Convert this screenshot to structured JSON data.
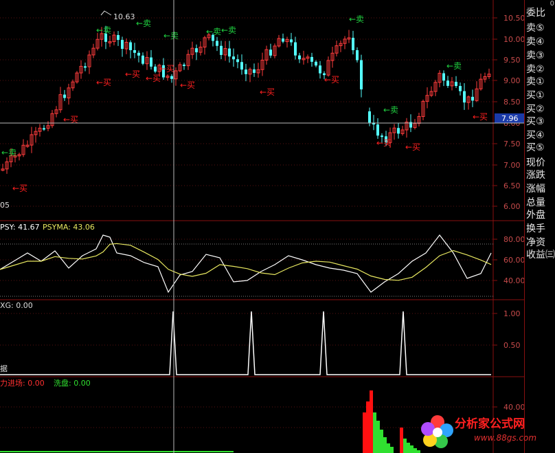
{
  "main_panel": {
    "price_axis": [
      "10.50",
      "10.00",
      "9.50",
      "9.00",
      "8.50",
      "8.00",
      "7.50",
      "7.00",
      "6.50",
      "6.00"
    ],
    "high_label": "10.63",
    "low_label_partial": "05",
    "current_price_tag": "7.96",
    "buy_label": "买",
    "sell_label": "卖"
  },
  "psy_panel": {
    "psy_label": "PSY: 41.67",
    "psyma_label": "PSYMA: 43.06",
    "axis": [
      "80.00",
      "60.00",
      "40.00"
    ]
  },
  "xg_panel": {
    "xg_label": "XG: 0.00",
    "axis": [
      "1.00",
      "0.50"
    ],
    "left_char": "据"
  },
  "capital_panel": {
    "inflow_label": "力进场: 0.00",
    "wash_label": "洗盘: 0.00",
    "axis": [
      "40.00"
    ]
  },
  "sidebar": {
    "top_badge": "0",
    "items": [
      "委比",
      "卖⑤",
      "卖④",
      "卖③",
      "卖②",
      "卖①",
      "买①",
      "买②",
      "买③",
      "买④",
      "买⑤",
      "现价",
      "涨跌",
      "涨幅",
      "总量",
      "外盘",
      "换手",
      "净资",
      "收益㈢"
    ]
  },
  "logo": {
    "title": "分析家公式网",
    "url": "www.88gs.com"
  },
  "colors": {
    "up": "#ff3c3c",
    "down": "#54ffff",
    "buy": "#ff2020",
    "sell": "#20d040",
    "psy_line": "#ffffff",
    "psyma_line": "#e8e860",
    "border": "#8a1010"
  }
}
